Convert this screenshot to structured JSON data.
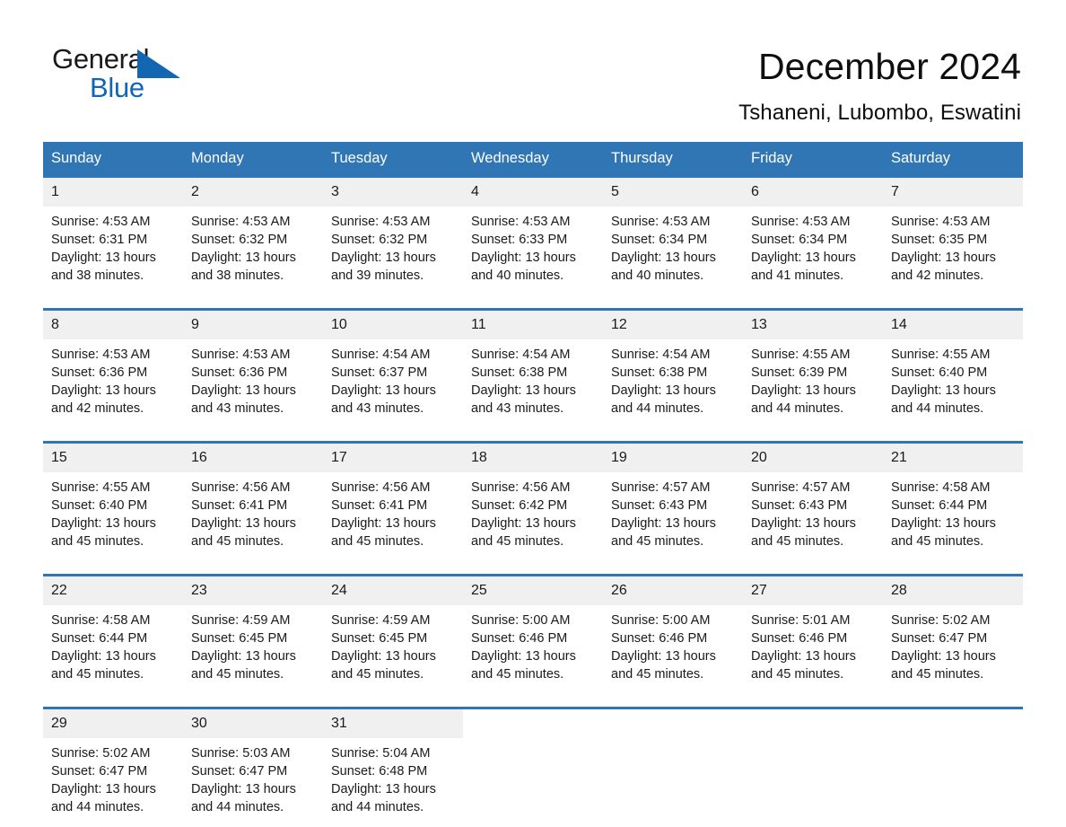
{
  "brand": {
    "name_part1": "General",
    "name_part2": "Blue",
    "triangle_color": "#1266b2"
  },
  "header": {
    "title": "December 2024",
    "subtitle": "Tshaneni, Lubombo, Eswatini"
  },
  "theme": {
    "header_blue": "#3076b5",
    "day_band_gray": "#f0f0f0",
    "text_color": "#1a1a1a",
    "page_background": "#ffffff"
  },
  "weekday_headers": [
    "Sunday",
    "Monday",
    "Tuesday",
    "Wednesday",
    "Thursday",
    "Friday",
    "Saturday"
  ],
  "weeks": [
    [
      {
        "day": "1",
        "sunrise": "Sunrise: 4:53 AM",
        "sunset": "Sunset: 6:31 PM",
        "daylight": "Daylight: 13 hours and 38 minutes."
      },
      {
        "day": "2",
        "sunrise": "Sunrise: 4:53 AM",
        "sunset": "Sunset: 6:32 PM",
        "daylight": "Daylight: 13 hours and 38 minutes."
      },
      {
        "day": "3",
        "sunrise": "Sunrise: 4:53 AM",
        "sunset": "Sunset: 6:32 PM",
        "daylight": "Daylight: 13 hours and 39 minutes."
      },
      {
        "day": "4",
        "sunrise": "Sunrise: 4:53 AM",
        "sunset": "Sunset: 6:33 PM",
        "daylight": "Daylight: 13 hours and 40 minutes."
      },
      {
        "day": "5",
        "sunrise": "Sunrise: 4:53 AM",
        "sunset": "Sunset: 6:34 PM",
        "daylight": "Daylight: 13 hours and 40 minutes."
      },
      {
        "day": "6",
        "sunrise": "Sunrise: 4:53 AM",
        "sunset": "Sunset: 6:34 PM",
        "daylight": "Daylight: 13 hours and 41 minutes."
      },
      {
        "day": "7",
        "sunrise": "Sunrise: 4:53 AM",
        "sunset": "Sunset: 6:35 PM",
        "daylight": "Daylight: 13 hours and 42 minutes."
      }
    ],
    [
      {
        "day": "8",
        "sunrise": "Sunrise: 4:53 AM",
        "sunset": "Sunset: 6:36 PM",
        "daylight": "Daylight: 13 hours and 42 minutes."
      },
      {
        "day": "9",
        "sunrise": "Sunrise: 4:53 AM",
        "sunset": "Sunset: 6:36 PM",
        "daylight": "Daylight: 13 hours and 43 minutes."
      },
      {
        "day": "10",
        "sunrise": "Sunrise: 4:54 AM",
        "sunset": "Sunset: 6:37 PM",
        "daylight": "Daylight: 13 hours and 43 minutes."
      },
      {
        "day": "11",
        "sunrise": "Sunrise: 4:54 AM",
        "sunset": "Sunset: 6:38 PM",
        "daylight": "Daylight: 13 hours and 43 minutes."
      },
      {
        "day": "12",
        "sunrise": "Sunrise: 4:54 AM",
        "sunset": "Sunset: 6:38 PM",
        "daylight": "Daylight: 13 hours and 44 minutes."
      },
      {
        "day": "13",
        "sunrise": "Sunrise: 4:55 AM",
        "sunset": "Sunset: 6:39 PM",
        "daylight": "Daylight: 13 hours and 44 minutes."
      },
      {
        "day": "14",
        "sunrise": "Sunrise: 4:55 AM",
        "sunset": "Sunset: 6:40 PM",
        "daylight": "Daylight: 13 hours and 44 minutes."
      }
    ],
    [
      {
        "day": "15",
        "sunrise": "Sunrise: 4:55 AM",
        "sunset": "Sunset: 6:40 PM",
        "daylight": "Daylight: 13 hours and 45 minutes."
      },
      {
        "day": "16",
        "sunrise": "Sunrise: 4:56 AM",
        "sunset": "Sunset: 6:41 PM",
        "daylight": "Daylight: 13 hours and 45 minutes."
      },
      {
        "day": "17",
        "sunrise": "Sunrise: 4:56 AM",
        "sunset": "Sunset: 6:41 PM",
        "daylight": "Daylight: 13 hours and 45 minutes."
      },
      {
        "day": "18",
        "sunrise": "Sunrise: 4:56 AM",
        "sunset": "Sunset: 6:42 PM",
        "daylight": "Daylight: 13 hours and 45 minutes."
      },
      {
        "day": "19",
        "sunrise": "Sunrise: 4:57 AM",
        "sunset": "Sunset: 6:43 PM",
        "daylight": "Daylight: 13 hours and 45 minutes."
      },
      {
        "day": "20",
        "sunrise": "Sunrise: 4:57 AM",
        "sunset": "Sunset: 6:43 PM",
        "daylight": "Daylight: 13 hours and 45 minutes."
      },
      {
        "day": "21",
        "sunrise": "Sunrise: 4:58 AM",
        "sunset": "Sunset: 6:44 PM",
        "daylight": "Daylight: 13 hours and 45 minutes."
      }
    ],
    [
      {
        "day": "22",
        "sunrise": "Sunrise: 4:58 AM",
        "sunset": "Sunset: 6:44 PM",
        "daylight": "Daylight: 13 hours and 45 minutes."
      },
      {
        "day": "23",
        "sunrise": "Sunrise: 4:59 AM",
        "sunset": "Sunset: 6:45 PM",
        "daylight": "Daylight: 13 hours and 45 minutes."
      },
      {
        "day": "24",
        "sunrise": "Sunrise: 4:59 AM",
        "sunset": "Sunset: 6:45 PM",
        "daylight": "Daylight: 13 hours and 45 minutes."
      },
      {
        "day": "25",
        "sunrise": "Sunrise: 5:00 AM",
        "sunset": "Sunset: 6:46 PM",
        "daylight": "Daylight: 13 hours and 45 minutes."
      },
      {
        "day": "26",
        "sunrise": "Sunrise: 5:00 AM",
        "sunset": "Sunset: 6:46 PM",
        "daylight": "Daylight: 13 hours and 45 minutes."
      },
      {
        "day": "27",
        "sunrise": "Sunrise: 5:01 AM",
        "sunset": "Sunset: 6:46 PM",
        "daylight": "Daylight: 13 hours and 45 minutes."
      },
      {
        "day": "28",
        "sunrise": "Sunrise: 5:02 AM",
        "sunset": "Sunset: 6:47 PM",
        "daylight": "Daylight: 13 hours and 45 minutes."
      }
    ],
    [
      {
        "day": "29",
        "sunrise": "Sunrise: 5:02 AM",
        "sunset": "Sunset: 6:47 PM",
        "daylight": "Daylight: 13 hours and 44 minutes."
      },
      {
        "day": "30",
        "sunrise": "Sunrise: 5:03 AM",
        "sunset": "Sunset: 6:47 PM",
        "daylight": "Daylight: 13 hours and 44 minutes."
      },
      {
        "day": "31",
        "sunrise": "Sunrise: 5:04 AM",
        "sunset": "Sunset: 6:48 PM",
        "daylight": "Daylight: 13 hours and 44 minutes."
      },
      {
        "day": "",
        "sunrise": "",
        "sunset": "",
        "daylight": ""
      },
      {
        "day": "",
        "sunrise": "",
        "sunset": "",
        "daylight": ""
      },
      {
        "day": "",
        "sunrise": "",
        "sunset": "",
        "daylight": ""
      },
      {
        "day": "",
        "sunrise": "",
        "sunset": "",
        "daylight": ""
      }
    ]
  ]
}
